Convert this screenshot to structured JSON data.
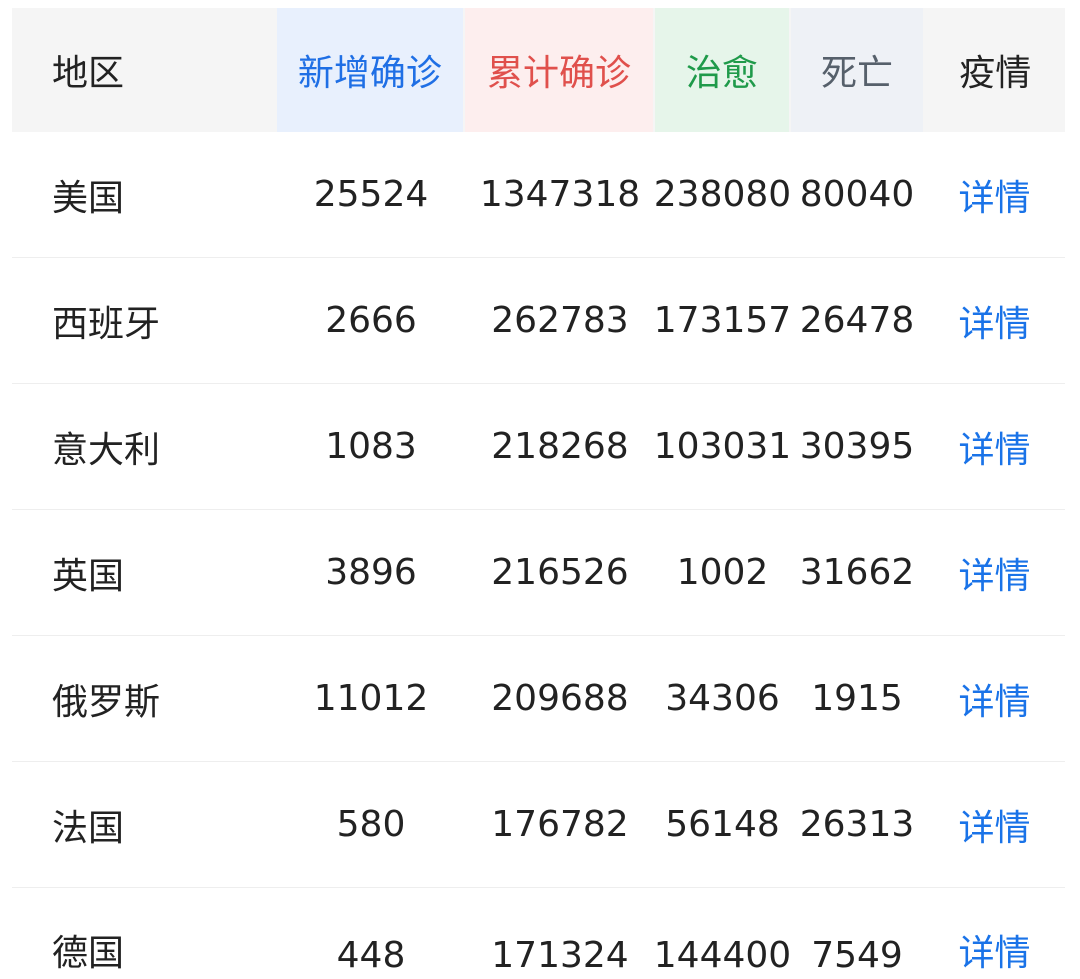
{
  "colors": {
    "new": "#1f6fe5",
    "total": "#e0504c",
    "cured": "#1f9a4a",
    "death": "#56606b",
    "link": "#1a73e8",
    "text": "#222222"
  },
  "header": {
    "region": "地区",
    "new": "新增确诊",
    "total": "累计确诊",
    "cured": "治愈",
    "death": "死亡",
    "detail": "疫情"
  },
  "rows": [
    {
      "region": "美国",
      "new": "25524",
      "total": "1347318",
      "cured": "238080",
      "death": "80040",
      "detail": "详情"
    },
    {
      "region": "西班牙",
      "new": "2666",
      "total": "262783",
      "cured": "173157",
      "death": "26478",
      "detail": "详情"
    },
    {
      "region": "意大利",
      "new": "1083",
      "total": "218268",
      "cured": "103031",
      "death": "30395",
      "detail": "详情"
    },
    {
      "region": "英国",
      "new": "3896",
      "total": "216526",
      "cured": "1002",
      "death": "31662",
      "detail": "详情"
    },
    {
      "region": "俄罗斯",
      "new": "11012",
      "total": "209688",
      "cured": "34306",
      "death": "1915",
      "detail": "详情"
    },
    {
      "region": "法国",
      "new": "580",
      "total": "176782",
      "cured": "56148",
      "death": "26313",
      "detail": "详情"
    },
    {
      "region": "德国",
      "new": "448",
      "total": "171324",
      "cured": "144400",
      "death": "7549",
      "detail": "详情"
    }
  ]
}
